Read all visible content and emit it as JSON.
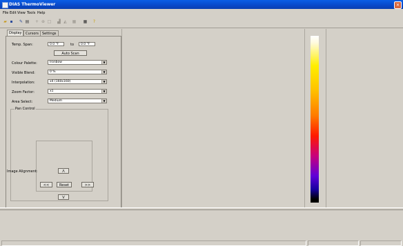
{
  "window": {
    "title": "DIAS ThermoViewer",
    "close_glyph": "✕"
  },
  "menu": [
    "File",
    "Edit",
    "View",
    "Tools",
    "Help"
  ],
  "toolbar": {
    "icons": [
      "open-icon",
      "save-icon",
      "report-icon",
      "print-icon",
      "add-icon",
      "zoom-icon",
      "area-icon",
      "histogram-icon",
      "profile-icon",
      "grid-icon",
      "palette-icon",
      "help-icon"
    ]
  },
  "tabs": [
    "Display",
    "Cursors",
    "Settings"
  ],
  "display": {
    "temp_span_label": "Temp. Span:",
    "temp_from": "0.0 °F",
    "temp_to_label": "to",
    "temp_to": "0.0 °F",
    "auto_scan_label": "Auto Scan",
    "colour_palette_label": "Colour Palette:",
    "colour_palette_value": "Ironbow",
    "visible_blend_label": "Visible Blend:",
    "visible_blend_value": "0 %",
    "interpolation_label": "Interpolation:",
    "interpolation_value": "x4 (160x160)",
    "zoom_factor_label": "Zoom Factor:",
    "zoom_factor_value": "x1",
    "area_select_label": "Area Select:",
    "area_select_value": "Medium",
    "pan_control_label": "Pan Control",
    "image_alignment_label": "Image Alignment:",
    "up_label": "Λ",
    "left_label": "<<",
    "reset_label": "Reset",
    "right_label": ">>",
    "down_label": "V"
  },
  "colors": {
    "titlebar": "#0848c9",
    "window": "#d4d0c8"
  }
}
